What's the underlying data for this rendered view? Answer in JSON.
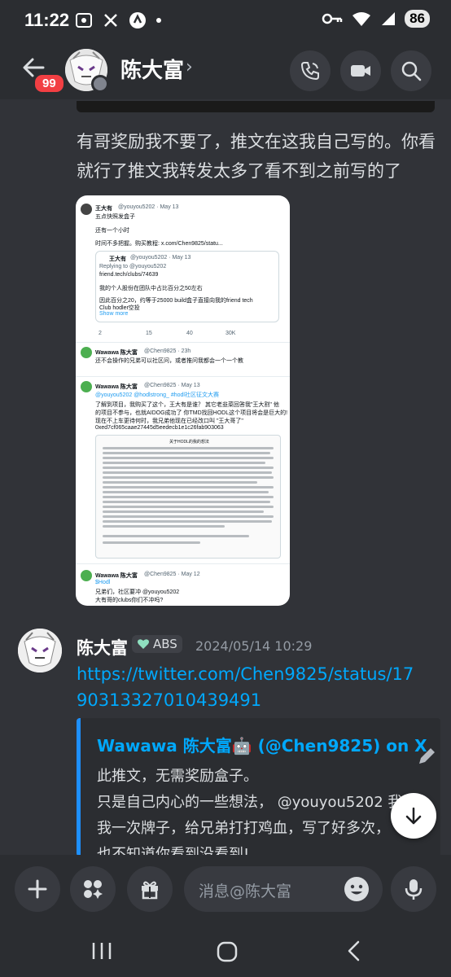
{
  "status_bar": {
    "time": "11:22",
    "battery": "86"
  },
  "header": {
    "unread_badge": "99",
    "title": "陈大富",
    "chevron": "›"
  },
  "message1": {
    "text": "有哥奖励我不要了，推文在这我自己写的。你看就行了推文我转发太多了看不到之前写的了"
  },
  "tweet_image": {
    "tweet1": {
      "name": "王大有",
      "handle": "@youyou5202 · May 13",
      "line1": "五点快照发盒子",
      "line2": "还有一个小时",
      "line3": "时间不多把握。购买教程: x.com/Chen9825/statu...",
      "quote": {
        "name": "王大有",
        "handle": "@youyou5202 · May 13",
        "reply": "Replying to @youyou5202",
        "link": "friend.tech/clubs/74639",
        "t1": "我的个人股份在团队中占比百分之50左右",
        "t2": "因此百分之20，约等于25000 build盒子直接向我的friend tech",
        "t3": "Club hodler空投",
        "more": "Show more"
      },
      "stats": [
        "2",
        "15",
        "40",
        "30K"
      ]
    },
    "tweet2": {
      "name": "Wawawa 陈大富",
      "handle": "@Chen9825 · 23h",
      "text": "还不会操作的兄弟可以社区问，或者推问我都会一个一个教"
    },
    "tweet3": {
      "name": "Wawawa 陈大富",
      "handle": "@Chen9825 · May 13",
      "tags": "@youyou5202 @hodlstrong_ #hodl社区征文大赛",
      "l1": "了解到项目，我购买了这个，王大有是谁？ 其它老韭菜回答我\"王大割\" 他",
      "l2": "的项目不参与，也就AIDOG成功了 你TMD找回HODL这个项目将会是巨大的!",
      "l3": "现在不上车更待何时，我兄弟他现在已经改口叫 \"王大哥了\"",
      "l4": "0xed7cf065caae27445d5eedecb1e1c26fab903063",
      "doc_title": "关于HODL的我的想法"
    },
    "tweet4": {
      "name": "Wawawa 陈大富",
      "handle": "@Chen9825 · May 12",
      "l1": "$Hodl",
      "l2": "兄弟们，社区要冲 @youyou5202",
      "l3": "大有哥的clubs你们不冲吗?"
    }
  },
  "message2": {
    "author": "陈大富",
    "tag": "ABS",
    "timestamp": "2024/05/14 10:29",
    "link": "https://twitter.com/Chen9825/status/1790313327010439491",
    "embed": {
      "title": "Wawawa 陈大富🤖 (@Chen9825) on X",
      "desc": "此推文，无需奖励盒子。\n只是自己内心的一些想法，  @youyou5202 我\n我一次牌子，给兄弟打打鸡血，写了好多次，\n也不知道你看到没看到!"
    }
  },
  "input": {
    "placeholder": "消息@陈大富"
  }
}
